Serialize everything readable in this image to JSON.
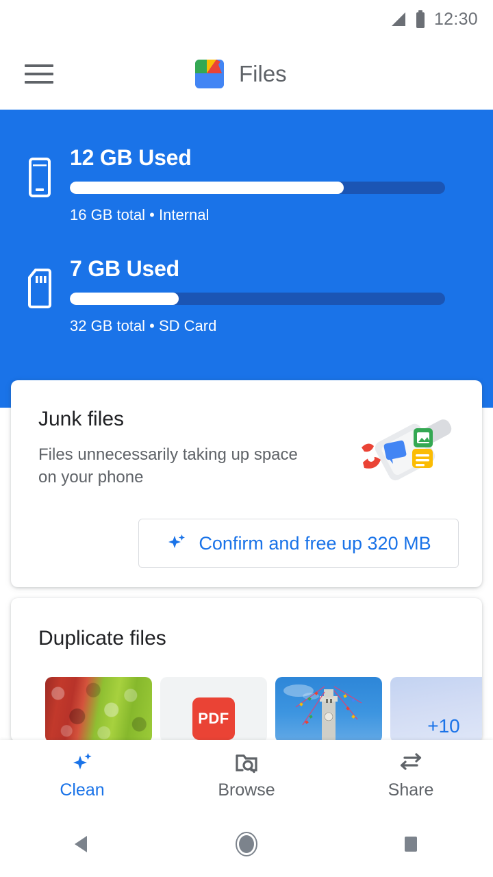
{
  "status_bar": {
    "time": "12:30",
    "signal_icon": "signal-triangle-icon",
    "battery_icon": "battery-icon"
  },
  "app_bar": {
    "menu_icon": "hamburger-menu-icon",
    "logo_icon": "files-app-logo",
    "title": "Files"
  },
  "storage": {
    "items": [
      {
        "icon": "phone-icon",
        "used_label": "12 GB Used",
        "detail": "16 GB total • Internal",
        "percent": 73
      },
      {
        "icon": "sd-card-icon",
        "used_label": "7 GB Used",
        "detail": "32 GB total • SD Card",
        "percent": 29
      }
    ],
    "panel_color": "#1a73e8",
    "track_color": "#1b55b4",
    "fill_color": "#ffffff"
  },
  "junk_card": {
    "title": "Junk files",
    "description": "Files unnecessarily taking up space on your phone",
    "illustration_icon": "dustpan-with-files-icon",
    "button": {
      "icon": "sparkle-icon",
      "label": "Confirm and free up 320 MB",
      "color": "#1a73e8"
    }
  },
  "duplicate_card": {
    "title": "Duplicate files",
    "thumbnails": [
      {
        "name": "apples-photo-thumbnail",
        "type": "image",
        "label": ""
      },
      {
        "name": "pdf-file-thumbnail",
        "type": "pdf",
        "label": "PDF"
      },
      {
        "name": "clock-tower-photo-thumbnail",
        "type": "image",
        "label": ""
      },
      {
        "name": "more-files-thumbnail",
        "type": "overflow",
        "label": "+10"
      }
    ]
  },
  "bottom_nav": {
    "items": [
      {
        "icon": "sparkle-icon",
        "label": "Clean",
        "active": true
      },
      {
        "icon": "folder-search-icon",
        "label": "Browse",
        "active": false
      },
      {
        "icon": "share-arrows-icon",
        "label": "Share",
        "active": false
      }
    ],
    "active_color": "#1a73e8",
    "inactive_color": "#5f6368"
  },
  "system_nav": {
    "back_icon": "back-triangle-icon",
    "home_icon": "home-circle-icon",
    "recents_icon": "recents-square-icon"
  }
}
